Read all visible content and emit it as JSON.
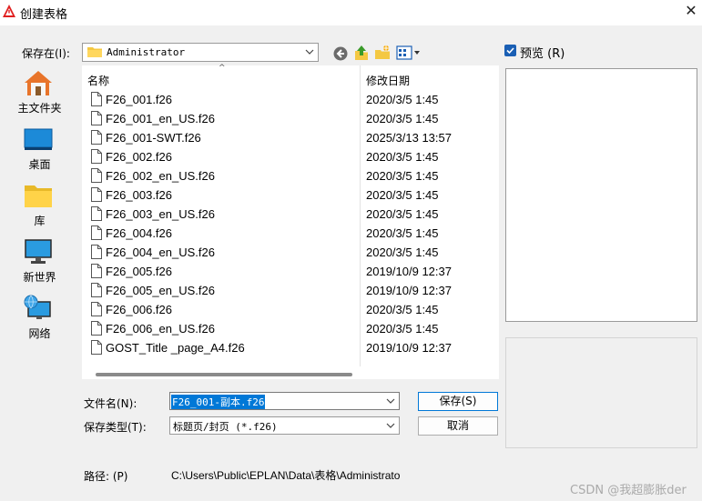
{
  "window": {
    "title": "创建表格",
    "close_glyph": "✕"
  },
  "toolbar": {
    "save_in_label": "保存在(I):",
    "location": "Administrator",
    "preview_label": "预览 (R)"
  },
  "places": [
    {
      "label": "主文件夹",
      "icon": "home-icon"
    },
    {
      "label": "桌面",
      "icon": "desktop-icon"
    },
    {
      "label": "库",
      "icon": "library-folder-icon"
    },
    {
      "label": "新世界",
      "icon": "monitor-icon"
    },
    {
      "label": "网络",
      "icon": "network-icon"
    }
  ],
  "filelist": {
    "columns": {
      "name": "名称",
      "date": "修改日期"
    },
    "sort_glyph": "^",
    "files": [
      {
        "name": "F26_001.f26",
        "date": "2020/3/5 1:45"
      },
      {
        "name": "F26_001_en_US.f26",
        "date": "2020/3/5 1:45"
      },
      {
        "name": "F26_001-SWT.f26",
        "date": "2025/3/13 13:57"
      },
      {
        "name": "F26_002.f26",
        "date": "2020/3/5 1:45"
      },
      {
        "name": "F26_002_en_US.f26",
        "date": "2020/3/5 1:45"
      },
      {
        "name": "F26_003.f26",
        "date": "2020/3/5 1:45"
      },
      {
        "name": "F26_003_en_US.f26",
        "date": "2020/3/5 1:45"
      },
      {
        "name": "F26_004.f26",
        "date": "2020/3/5 1:45"
      },
      {
        "name": "F26_004_en_US.f26",
        "date": "2020/3/5 1:45"
      },
      {
        "name": "F26_005.f26",
        "date": "2019/10/9 12:37"
      },
      {
        "name": "F26_005_en_US.f26",
        "date": "2019/10/9 12:37"
      },
      {
        "name": "F26_006.f26",
        "date": "2020/3/5 1:45"
      },
      {
        "name": "F26_006_en_US.f26",
        "date": "2020/3/5 1:45"
      },
      {
        "name": "GOST_Title _page_A4.f26",
        "date": "2019/10/9 12:37"
      }
    ]
  },
  "form": {
    "filename_label": "文件名(N):",
    "filename_value": "F26_001-副本.f26",
    "filetype_label": "保存类型(T):",
    "filetype_value": "标题页/封页 (*.f26)",
    "save_label": "保存(S)",
    "cancel_label": "取消",
    "path_label": "路径: (P)",
    "path_value": "C:\\Users\\Public\\EPLAN\\Data\\表格\\Administrator"
  },
  "watermark": "CSDN @我超膨胀der",
  "colors": {
    "accent": "#0078d7",
    "folder": "#f4c842"
  }
}
